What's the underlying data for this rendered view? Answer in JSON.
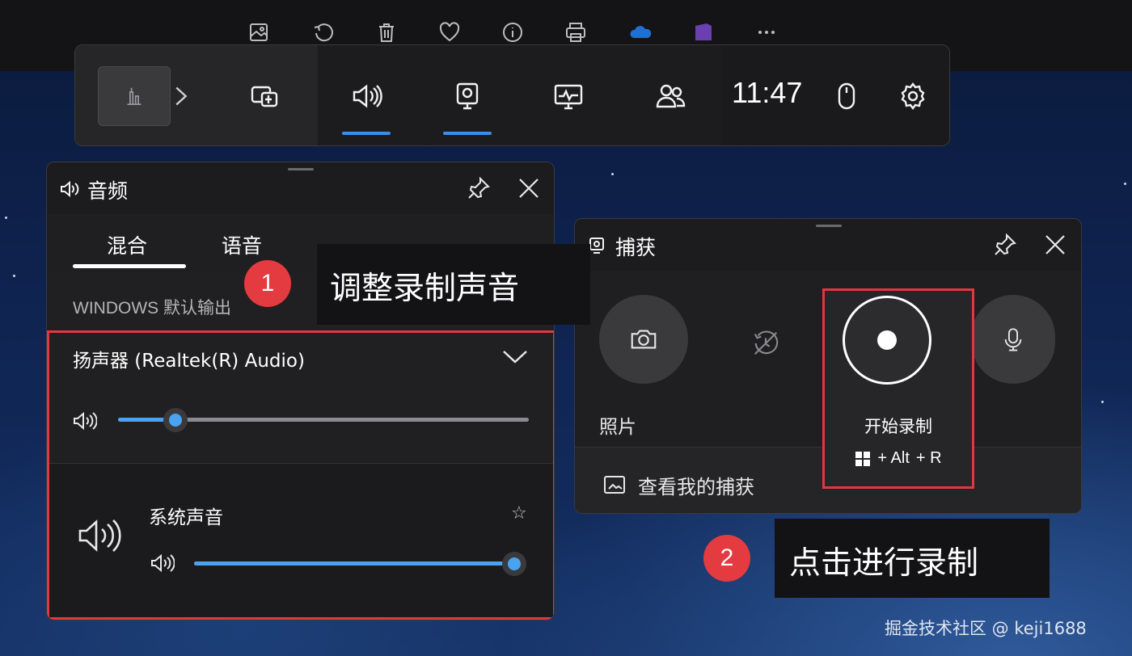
{
  "top_toolbar": {
    "icons": [
      "edit-image-icon",
      "rotate-icon",
      "delete-icon",
      "favorite-icon",
      "info-icon",
      "print-icon",
      "onedrive-icon",
      "app-icon",
      "more-icon"
    ]
  },
  "game_bar": {
    "clock": "11:47",
    "buttons": [
      "widget-menu-icon",
      "audio-icon",
      "capture-icon",
      "performance-icon",
      "social-icon"
    ],
    "active": [
      "audio-icon",
      "capture-icon"
    ]
  },
  "audio": {
    "title": "音频",
    "tabs": [
      "混合",
      "语音"
    ],
    "active_tab": "混合",
    "section_label": "WINDOWS 默认输出",
    "device": "扬声器 (Realtek(R) Audio)",
    "device_volume": 0.14,
    "app_name": "系统声音",
    "app_volume": 1.0
  },
  "capture": {
    "title": "捕获",
    "photo_label": "照片",
    "record_label": "开始录制",
    "shortcut_plus_alt": "+ Alt",
    "shortcut_plus_r": "+ R",
    "gallery_label": "查看我的捕获"
  },
  "annotations": {
    "badge1": "1",
    "callout1": "调整录制声音",
    "badge2": "2",
    "callout2": "点击进行录制"
  },
  "watermark": "掘金技术社区 @ keji1688",
  "colors": {
    "accent": "#4aa3f0",
    "highlight_red": "#e0383e",
    "badge_red": "#e33b3f",
    "panel_bg": "#202022"
  }
}
